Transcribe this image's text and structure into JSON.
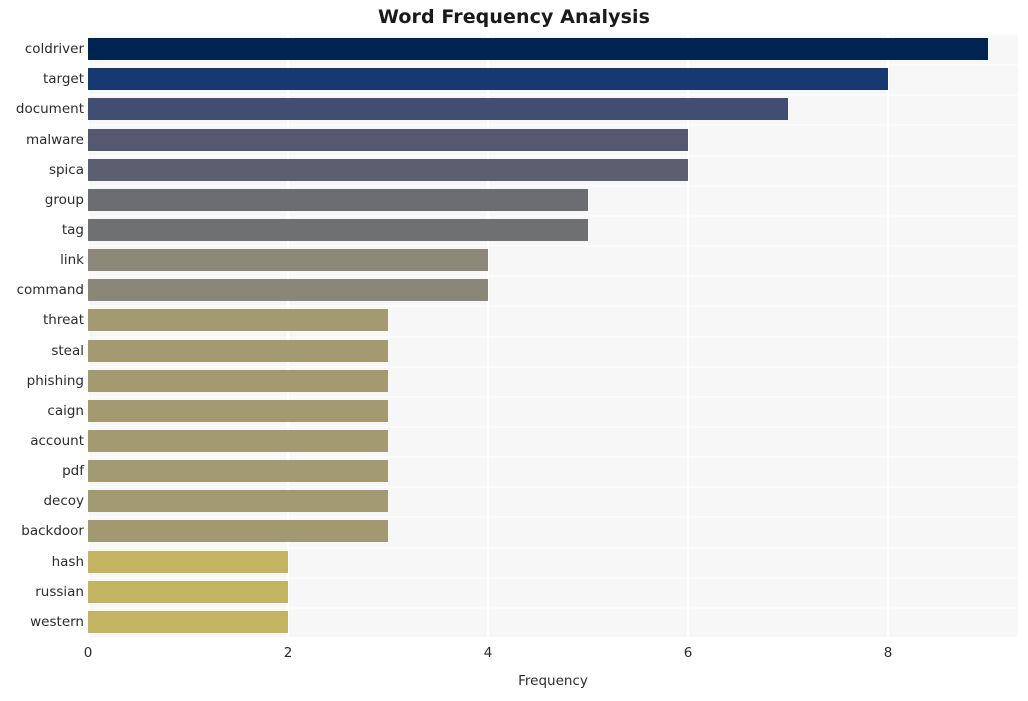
{
  "chart_data": {
    "type": "bar",
    "orientation": "horizontal",
    "title": "Word Frequency Analysis",
    "xlabel": "Frequency",
    "ylabel": "",
    "categories": [
      "coldriver",
      "target",
      "document",
      "malware",
      "spica",
      "group",
      "tag",
      "link",
      "command",
      "threat",
      "steal",
      "phishing",
      "caign",
      "account",
      "pdf",
      "decoy",
      "backdoor",
      "hash",
      "russian",
      "western"
    ],
    "values": [
      9,
      8,
      7,
      6,
      6,
      5,
      5,
      4,
      4,
      3,
      3,
      3,
      3,
      3,
      3,
      3,
      3,
      2,
      2,
      2
    ],
    "bar_colors": [
      "#00234f",
      "#173870",
      "#414d71",
      "#545871",
      "#5b5f70",
      "#6b6d71",
      "#6e7072",
      "#8b8879",
      "#898778",
      "#a39a71",
      "#a39a71",
      "#a39a71",
      "#a39a71",
      "#a39a71",
      "#a29a72",
      "#a29a72",
      "#a29973",
      "#c3b462",
      "#c3b462",
      "#c3b462"
    ],
    "xticks": [
      0,
      2,
      4,
      6,
      8
    ],
    "xlim": [
      0,
      9.3
    ],
    "grid": true,
    "legend": "none",
    "plot_background": "#f7f7f7",
    "figure_background": "#ffffff",
    "gridline_color": "#ffffff",
    "text_color": "#2b2b2b"
  }
}
